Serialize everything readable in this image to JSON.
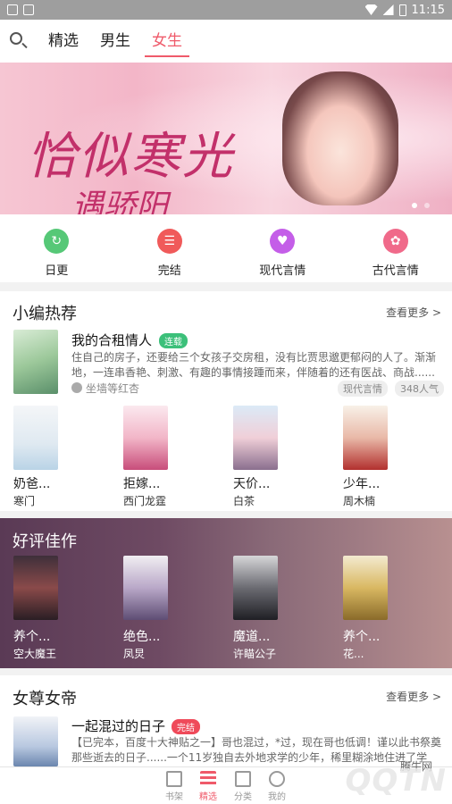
{
  "status_bar": {
    "time": "11:15"
  },
  "top_nav": {
    "tabs": [
      "精选",
      "男生",
      "女生"
    ],
    "active": "女生"
  },
  "banner": {
    "title": "恰似寒光",
    "subtitle": "遇骄阳"
  },
  "categories": [
    {
      "label": "日更",
      "color": "#56c877"
    },
    {
      "label": "完结",
      "color": "#f05a5a"
    },
    {
      "label": "现代言情",
      "color": "#c45ee8"
    },
    {
      "label": "古代言情",
      "color": "#f06a8a"
    }
  ],
  "editor_picks": {
    "title": "小编热荐",
    "more": "查看更多 >",
    "featured": {
      "title": "我的合租情人",
      "badge": "连载",
      "description": "住自己的房子，还要给三个女孩子交房租，没有比贾思邈更郁闷的人了。渐渐地，一连串香艳、刺激、有趣的事情接踵而来，伴随着的还有医战、商战......",
      "author": "坐墙等红杏",
      "tag": "现代言情",
      "popularity": "348人气"
    },
    "books": [
      {
        "name": "奶爸...",
        "author": "寒门"
      },
      {
        "name": "拒嫁...",
        "author": "西门龙霆"
      },
      {
        "name": "天价...",
        "author": "白茶"
      },
      {
        "name": "少年...",
        "author": "周木楠"
      }
    ]
  },
  "good_reviews": {
    "title": "好评佳作",
    "books": [
      {
        "name": "养个...",
        "author": "空大魔王"
      },
      {
        "name": "绝色...",
        "author": "凤炅"
      },
      {
        "name": "魔道...",
        "author": "许瞄公子"
      },
      {
        "name": "养个...",
        "author": "花..."
      }
    ]
  },
  "queen_section": {
    "title": "女尊女帝",
    "more": "查看更多 >",
    "featured": {
      "title": "一起混过的日子",
      "badge": "完结",
      "description": "【已完本，百度十大神贴之一】哥也混过，*过，现在哥也低调！谨以此书祭奠那些逝去的日子......一个11岁独自去外地求学的少年，稀里糊涂地住进了学校..."
    }
  },
  "bottom_nav": {
    "items": [
      "书架",
      "精选",
      "分类",
      "我的"
    ],
    "active": "精选"
  },
  "watermark": {
    "text": "QQTN",
    "site": "腾牛网"
  }
}
